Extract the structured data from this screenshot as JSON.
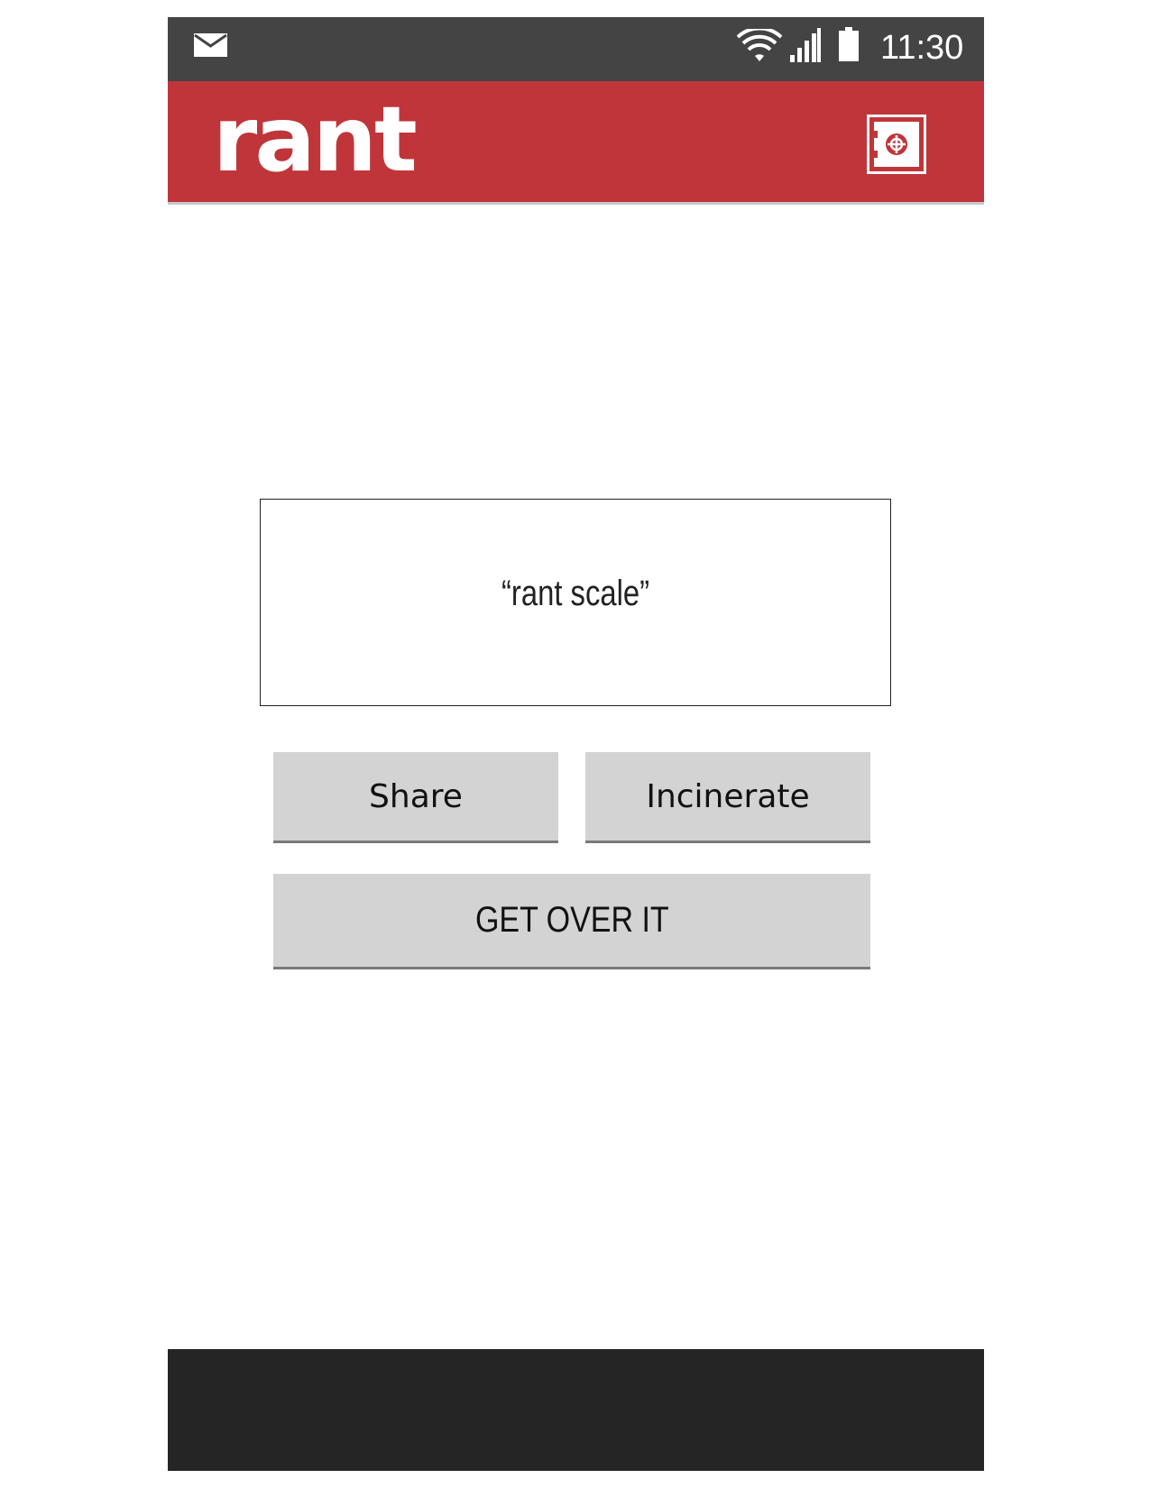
{
  "status_bar": {
    "time": "11:30",
    "icons": [
      "mail-icon",
      "wifi-icon",
      "signal-icon",
      "battery-icon"
    ]
  },
  "app_bar": {
    "logo": "rant",
    "action_icon": "vault-icon"
  },
  "main": {
    "scale_text": "“rant scale”",
    "share_label": "Share",
    "incinerate_label": "Incinerate",
    "get_over_label": "GET OVER IT"
  },
  "colors": {
    "status_bar": "#444444",
    "app_bar": "#c0353a",
    "button": "#d3d3d3",
    "button_border": "#7a7a7a",
    "bottom_bar": "#262526"
  }
}
